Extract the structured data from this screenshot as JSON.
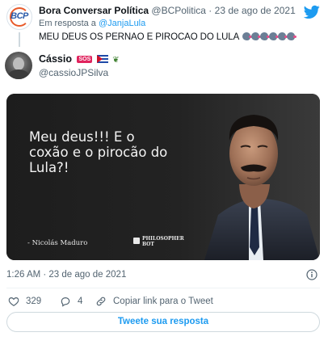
{
  "parent_tweet": {
    "display_name": "Bora Conversar Política",
    "handle": "@BCPolitica",
    "separator": "·",
    "date": "23 de ago de 2021",
    "reply_prefix": "Em resposta a",
    "reply_mention": "@JanjaLula",
    "text": "MEU DEUS OS PERNAO E PIROCAO DO LULA",
    "avatar_text": "BCP"
  },
  "tweet": {
    "display_name": "Cássio",
    "name_badge": "SOS",
    "handle": "@cassioJPSilva",
    "image": {
      "quote": "Meu deus!!! E o coxão e o pirocão do Lula?!",
      "author": "- Nicolás Maduro",
      "brand_line1": "PHILOSOPHER",
      "brand_line2": "BOT"
    },
    "timestamp": "1:26 AM · 23 de ago de 2021",
    "likes": "329",
    "replies": "4",
    "copy_link_label": "Copiar link para o Tweet",
    "reply_button_label": "Tweete sua resposta"
  },
  "icons": [
    "bcp-logo",
    "twitter-bird-icon",
    "grimace-emoji",
    "sos-badge",
    "cuba-flag",
    "leaf-icon",
    "more-icon",
    "heart-icon",
    "comment-icon",
    "link-icon"
  ],
  "colors": {
    "accent": "#1d9bf0",
    "text": "#0f1419",
    "muted": "#536471",
    "border": "#cfd9de",
    "image_bg": "#1c1c1c"
  }
}
